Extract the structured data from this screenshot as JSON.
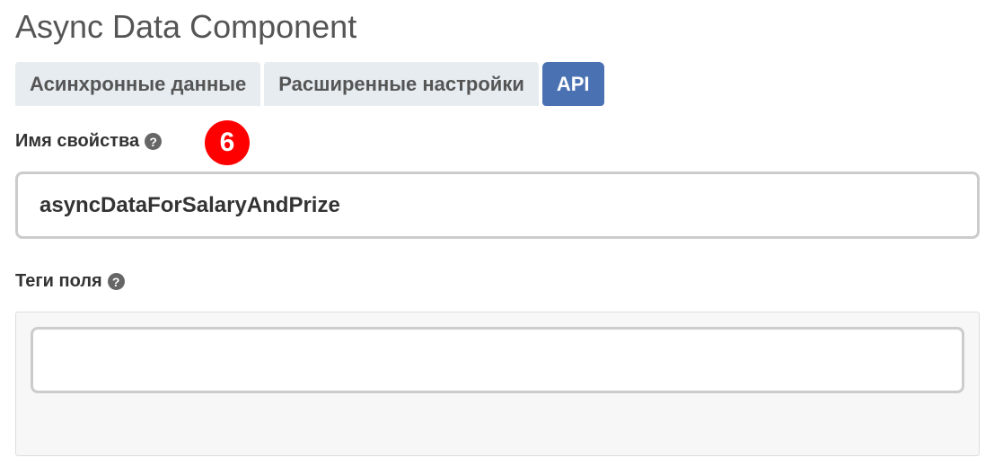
{
  "page": {
    "title": "Async Data Component"
  },
  "tabs": [
    {
      "label": "Асинхронные данные",
      "active": false
    },
    {
      "label": "Расширенные настройки",
      "active": false
    },
    {
      "label": "API",
      "active": true
    }
  ],
  "property_name": {
    "label": "Имя свойства",
    "help_icon": "question-circle-icon",
    "value": "asyncDataForSalaryAndPrize"
  },
  "step_badge": {
    "number": "6",
    "color": "#ff0000"
  },
  "field_tags": {
    "label": "Теги поля",
    "help_icon": "question-circle-icon",
    "value": ""
  },
  "colors": {
    "active_tab": "#4a72b2",
    "inactive_tab": "#e6ecf0"
  }
}
